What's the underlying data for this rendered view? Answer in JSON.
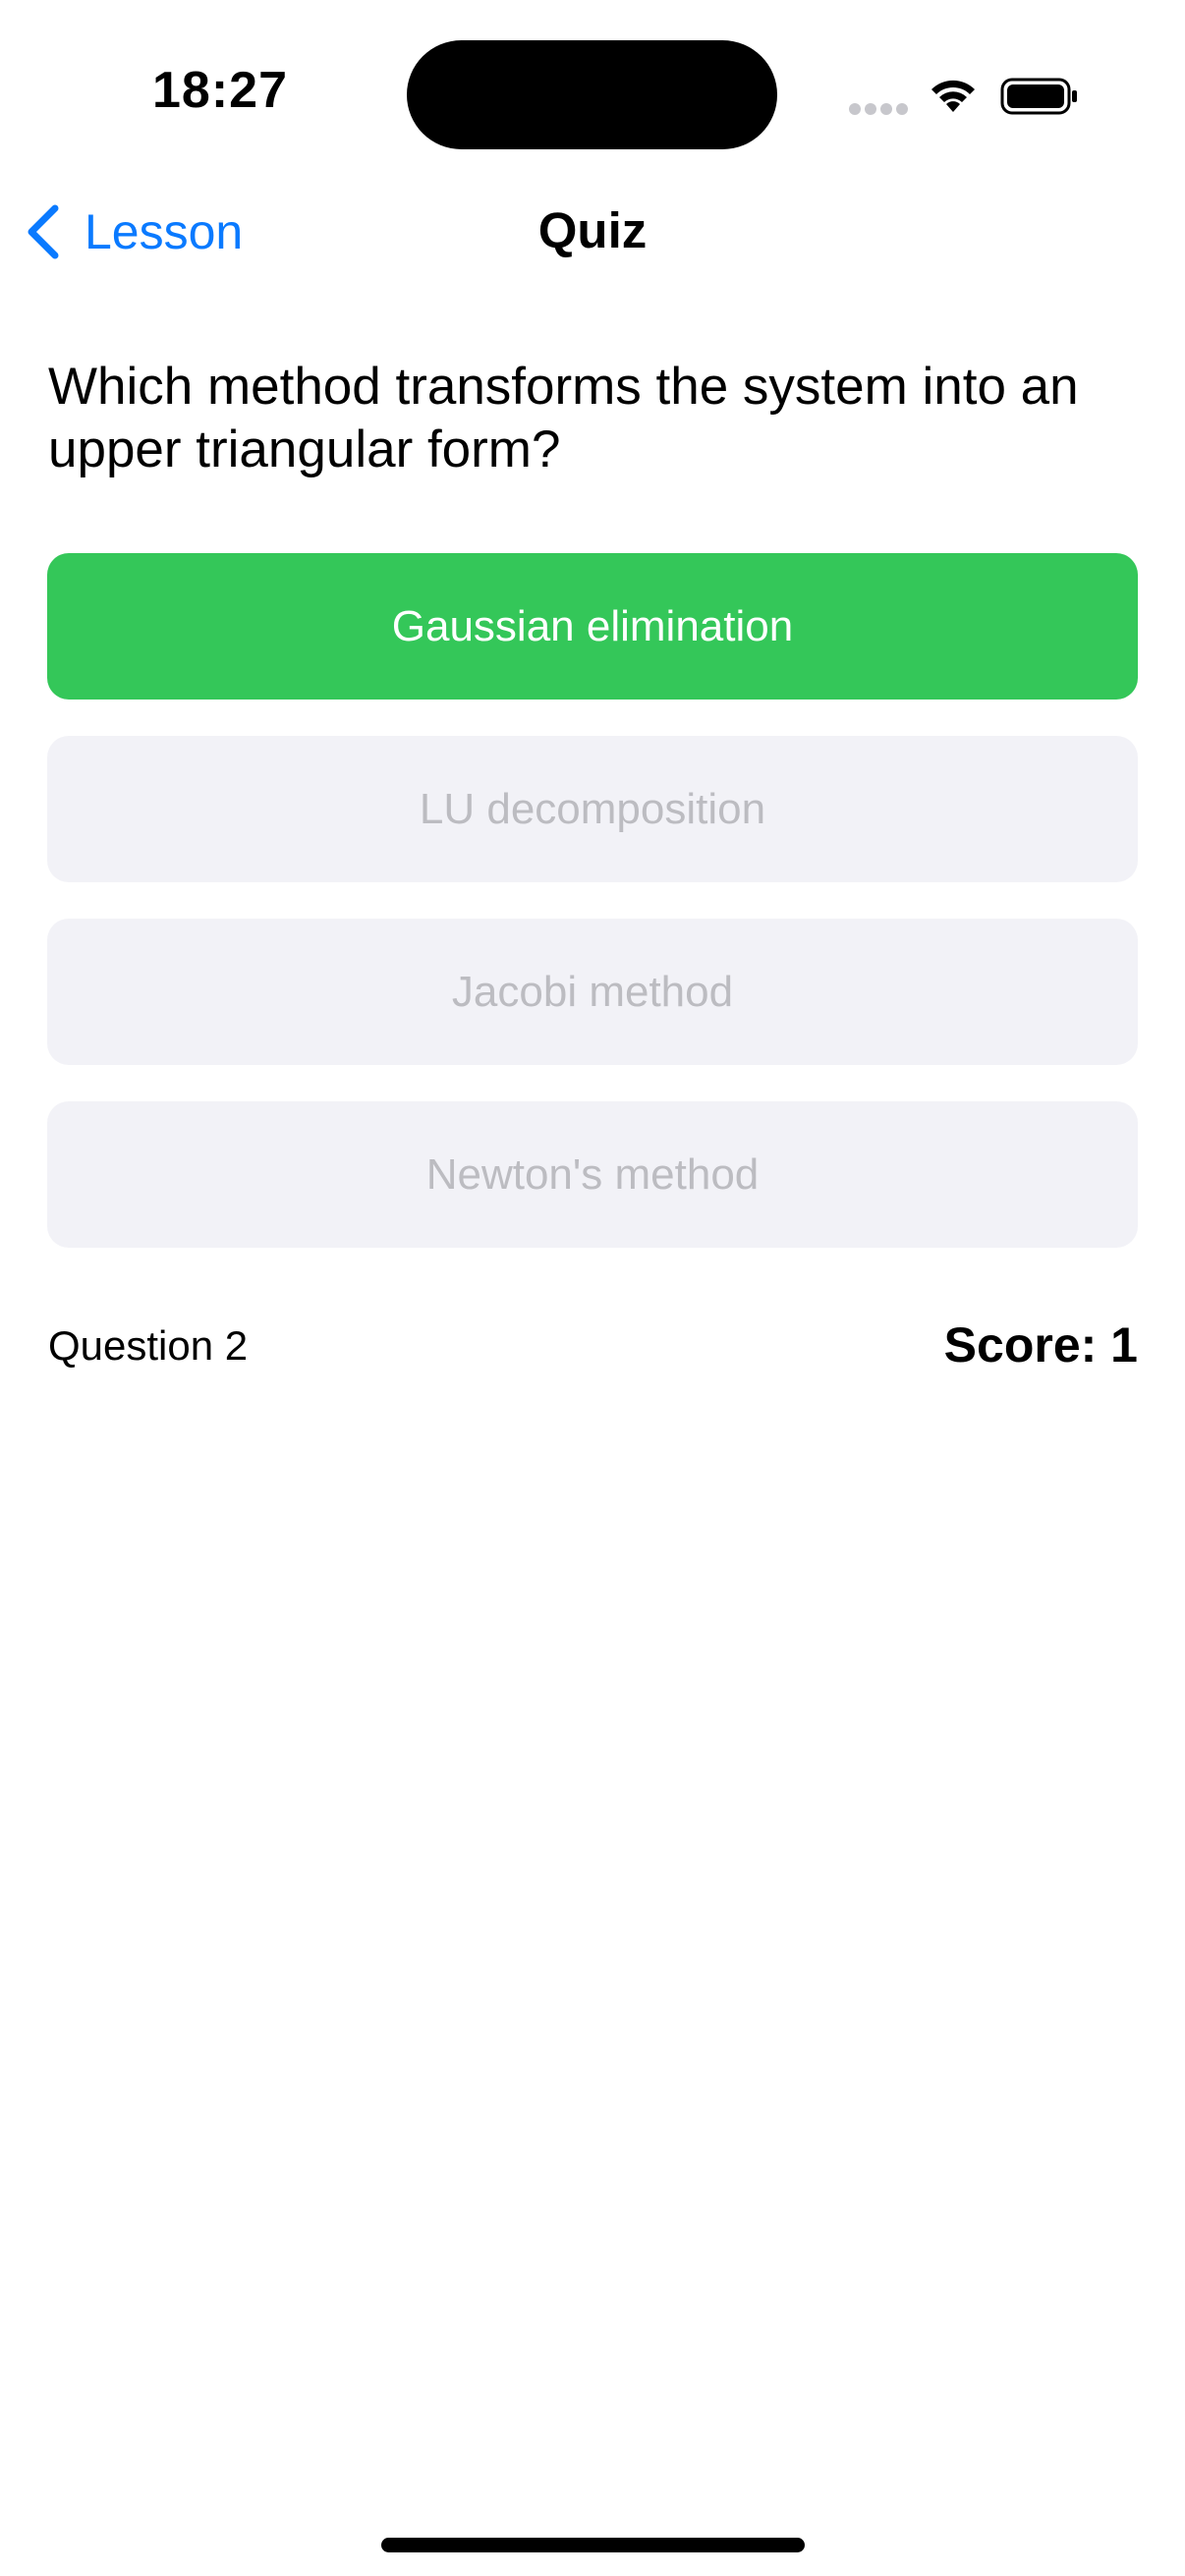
{
  "status_bar": {
    "time": "18:27"
  },
  "nav": {
    "back_label": "Lesson",
    "title": "Quiz"
  },
  "quiz": {
    "question": "Which method transforms the system into an upper triangular form?",
    "options": [
      {
        "label": "Gaussian elimination",
        "state": "correct"
      },
      {
        "label": "LU decomposition",
        "state": "disabled"
      },
      {
        "label": "Jacobi method",
        "state": "disabled"
      },
      {
        "label": "Newton's method",
        "state": "disabled"
      }
    ],
    "question_number": "Question 2",
    "score": "Score: 1"
  },
  "colors": {
    "accent": "#0a7aff",
    "correct": "#34c759",
    "disabled_bg": "#f2f2f7",
    "disabled_text": "#bcbcc1"
  },
  "icons": {
    "back": "chevron-left-icon",
    "wifi": "wifi-icon",
    "battery": "battery-icon",
    "cellular": "cellular-dots-icon"
  }
}
